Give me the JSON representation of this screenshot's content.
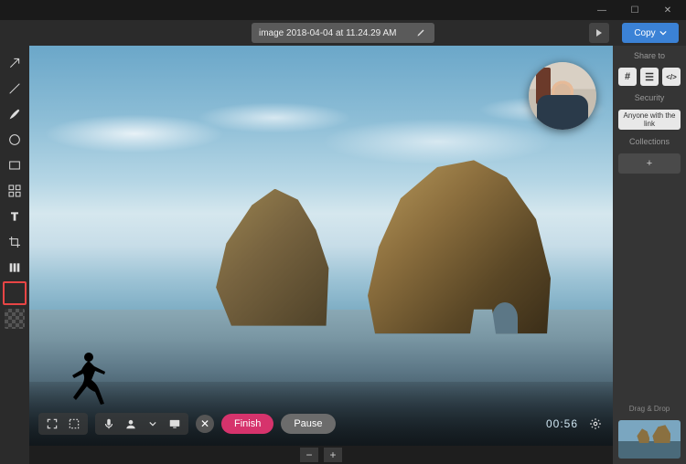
{
  "window": {
    "minimize": "—",
    "maximize": "☐",
    "close": "✕"
  },
  "header": {
    "filename": "image 2018-04-04 at 11.24.29 AM",
    "copy_label": "Copy"
  },
  "tools": [
    {
      "name": "arrow-tool"
    },
    {
      "name": "line-tool"
    },
    {
      "name": "brush-tool"
    },
    {
      "name": "ellipse-tool"
    },
    {
      "name": "rectangle-tool"
    },
    {
      "name": "blur-tool"
    },
    {
      "name": "text-tool"
    },
    {
      "name": "crop-tool"
    },
    {
      "name": "columns-tool"
    },
    {
      "name": "color-swatch",
      "selected": true
    },
    {
      "name": "transparency-tool"
    }
  ],
  "recording": {
    "finish_label": "Finish",
    "pause_label": "Pause",
    "timer": "00:56"
  },
  "sidebar": {
    "share_label": "Share to",
    "share_targets": [
      {
        "name": "share-slack",
        "glyph": "#"
      },
      {
        "name": "share-trello",
        "glyph": "☰"
      },
      {
        "name": "share-embed",
        "glyph": "</>"
      }
    ],
    "security_label": "Security",
    "security_value": "Anyone with the link",
    "collections_label": "Collections",
    "dragdrop_label": "Drag & Drop"
  },
  "zoom": {
    "out": "−",
    "in": "+"
  }
}
